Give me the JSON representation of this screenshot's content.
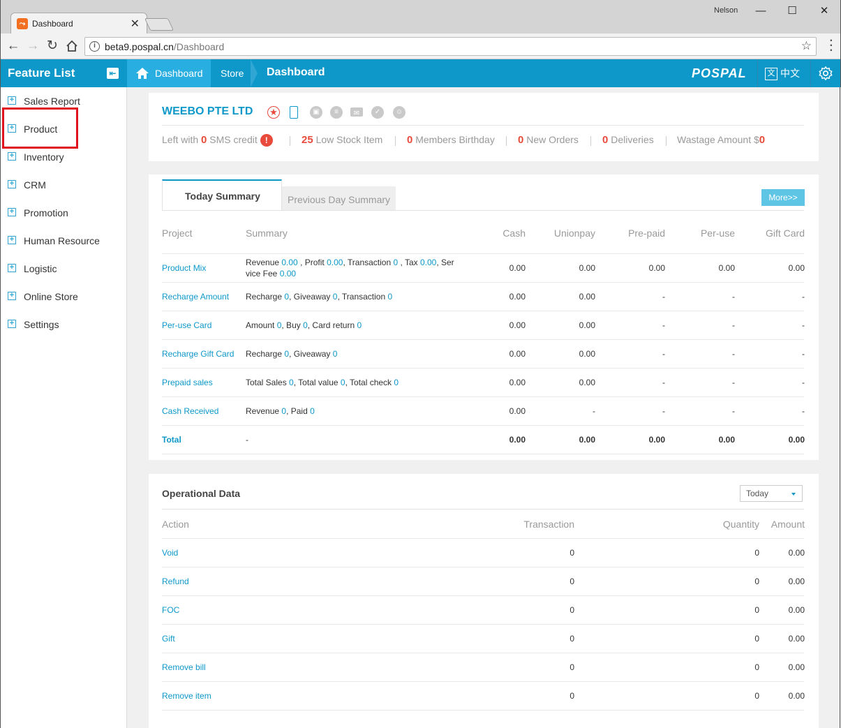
{
  "browser": {
    "tab_title": "Dashboard",
    "user": "Nelson",
    "url_host": "beta9.pospal.cn",
    "url_path": "/Dashboard"
  },
  "header": {
    "feature_list": "Feature List",
    "crumbs": {
      "home": "Dashboard",
      "store": "Store",
      "current": "Dashboard"
    },
    "logo": "POSPAL",
    "lang_icon": "文",
    "lang": "中文"
  },
  "sidebar": {
    "items": [
      {
        "label": "Sales Report"
      },
      {
        "label": "Product"
      },
      {
        "label": "Inventory"
      },
      {
        "label": "CRM"
      },
      {
        "label": "Promotion"
      },
      {
        "label": "Human Resource"
      },
      {
        "label": "Logistic"
      },
      {
        "label": "Online Store"
      },
      {
        "label": "Settings"
      }
    ]
  },
  "company": {
    "name": "WEEBO PTE LTD",
    "stats": [
      {
        "prefix": "Left with ",
        "num": "0",
        "suffix": " SMS credit"
      },
      {
        "prefix": "",
        "num": "25",
        "suffix": " Low Stock Item"
      },
      {
        "prefix": "",
        "num": "0",
        "suffix": " Members Birthday"
      },
      {
        "prefix": "",
        "num": "0",
        "suffix": " New Orders"
      },
      {
        "prefix": "",
        "num": "0",
        "suffix": " Deliveries"
      },
      {
        "prefix": "Wastage Amount $",
        "num": "0",
        "suffix": ""
      }
    ]
  },
  "summary": {
    "tabs": [
      "Today Summary",
      "Previous Day Summary"
    ],
    "more": "More>>",
    "headers": [
      "Project",
      "Summary",
      "Cash",
      "Unionpay",
      "Pre-paid",
      "Per-use",
      "Gift Card"
    ],
    "rows": [
      {
        "project": "Product Mix",
        "summary": [
          [
            "Revenue ",
            "0.00"
          ],
          [
            " , Profit ",
            "0.00"
          ],
          [
            ", Transaction ",
            "0"
          ],
          [
            " , Tax ",
            "0.00"
          ],
          [
            ", Ser vice Fee ",
            "0.00"
          ]
        ],
        "values": [
          "0.00",
          "0.00",
          "0.00",
          "0.00",
          "0.00"
        ]
      },
      {
        "project": "Recharge Amount",
        "summary": [
          [
            "Recharge ",
            "0"
          ],
          [
            ", Giveaway ",
            "0"
          ],
          [
            ", Transaction ",
            "0"
          ]
        ],
        "values": [
          "0.00",
          "0.00",
          "-",
          "-",
          "-"
        ]
      },
      {
        "project": "Per-use Card",
        "summary": [
          [
            "Amount ",
            "0"
          ],
          [
            ", Buy ",
            "0"
          ],
          [
            ", Card return ",
            "0"
          ]
        ],
        "values": [
          "0.00",
          "0.00",
          "-",
          "-",
          "-"
        ]
      },
      {
        "project": "Recharge Gift Card",
        "summary": [
          [
            "Recharge ",
            "0"
          ],
          [
            ", Giveaway ",
            "0"
          ]
        ],
        "values": [
          "0.00",
          "0.00",
          "-",
          "-",
          "-"
        ]
      },
      {
        "project": "Prepaid sales",
        "summary": [
          [
            "Total Sales ",
            "0"
          ],
          [
            ", Total value ",
            "0"
          ],
          [
            ", Total check ",
            "0"
          ]
        ],
        "values": [
          "0.00",
          "0.00",
          "-",
          "-",
          "-"
        ]
      },
      {
        "project": "Cash Received",
        "summary": [
          [
            "Revenue ",
            "0"
          ],
          [
            ", Paid ",
            "0"
          ]
        ],
        "values": [
          "0.00",
          "-",
          "-",
          "-",
          "-"
        ]
      }
    ],
    "total": {
      "label": "Total",
      "summary": "-",
      "values": [
        "0.00",
        "0.00",
        "0.00",
        "0.00",
        "0.00"
      ]
    }
  },
  "operational": {
    "title": "Operational Data",
    "period": "Today",
    "headers": [
      "Action",
      "Transaction",
      "Quantity",
      "Amount"
    ],
    "rows": [
      {
        "action": "Void",
        "transaction": "0",
        "quantity": "0",
        "amount": "0.00"
      },
      {
        "action": "Refund",
        "transaction": "0",
        "quantity": "0",
        "amount": "0.00"
      },
      {
        "action": "FOC",
        "transaction": "0",
        "quantity": "0",
        "amount": "0.00"
      },
      {
        "action": "Gift",
        "transaction": "0",
        "quantity": "0",
        "amount": "0.00"
      },
      {
        "action": "Remove bill",
        "transaction": "0",
        "quantity": "0",
        "amount": "0.00"
      },
      {
        "action": "Remove item",
        "transaction": "0",
        "quantity": "0",
        "amount": "0.00"
      }
    ]
  },
  "colors": {
    "brand": "#0d98c9",
    "alert": "#e84a3b",
    "highlight": "#e0141e"
  },
  "icons": [
    "star-icon",
    "mobile-icon",
    "lock-icon",
    "chat-icon",
    "mail-icon",
    "check-icon",
    "user-icon"
  ]
}
